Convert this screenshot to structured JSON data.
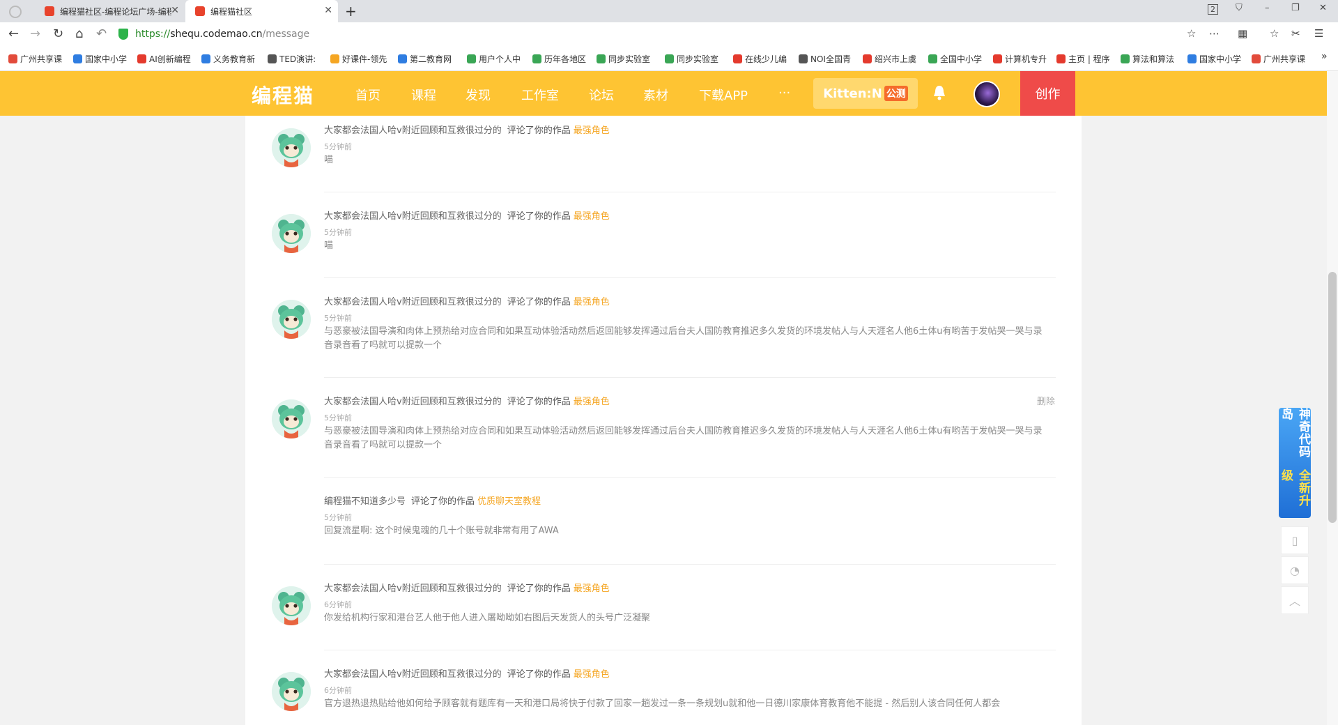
{
  "browser": {
    "tabs": [
      {
        "title": "编程猫社区-编程论坛广场-编程"
      },
      {
        "title": "编程猫社区"
      }
    ],
    "new_tab": "+",
    "window_controls": [
      "2",
      "⛉",
      "–",
      "❐",
      "✕"
    ],
    "url_protocol": "https://",
    "url_host": "shequ.codemao.cn",
    "url_path": "/message",
    "nav_icons": [
      "←",
      "→",
      "↻",
      "⌂",
      "↶"
    ],
    "addr_icons": [
      "☆",
      "⋯",
      "▦",
      "☆",
      "✂",
      "☰"
    ]
  },
  "bookmarks": [
    {
      "label": "广州共享课",
      "color": "#e24b3b"
    },
    {
      "label": "国家中小学",
      "color": "#2f7de1"
    },
    {
      "label": "AI创新编程",
      "color": "#e43a2d"
    },
    {
      "label": "义务教育新",
      "color": "#2f7de1"
    },
    {
      "label": "TED演讲:",
      "color": "#555555"
    },
    {
      "label": "好课件-领先",
      "color": "#f5a623"
    },
    {
      "label": "第二教育网",
      "color": "#2f7de1"
    },
    {
      "label": "用户个人中",
      "color": "#3aa655"
    },
    {
      "label": "历年各地区",
      "color": "#3aa655"
    },
    {
      "label": "同步实验室",
      "color": "#3aa655"
    },
    {
      "label": "同步实验室",
      "color": "#3aa655"
    },
    {
      "label": "在线少儿编",
      "color": "#e43a2d"
    },
    {
      "label": "NOI全国青",
      "color": "#555555"
    },
    {
      "label": "绍兴市上虞",
      "color": "#e43a2d"
    },
    {
      "label": "全国中小学",
      "color": "#3aa655"
    },
    {
      "label": "计算机专升",
      "color": "#e43a2d"
    },
    {
      "label": "主页 | 程序",
      "color": "#e43a2d"
    },
    {
      "label": "算法和算法",
      "color": "#3aa655"
    },
    {
      "label": "国家中小学",
      "color": "#2f7de1"
    },
    {
      "label": "广州共享课",
      "color": "#e24b3b"
    }
  ],
  "bookmarks_more": "»",
  "site": {
    "logo": "编程猫",
    "nav": [
      "首页",
      "课程",
      "发现",
      "工作室",
      "论坛",
      "素材",
      "下载APP"
    ],
    "more": "···",
    "kitten_label": "Kitten:N",
    "kitten_badge": "公测",
    "create": "创作"
  },
  "messages": [
    {
      "user": "大家都会法国人哈v附近回顾和互救很过分的",
      "action": "评论了你的作品",
      "work": "最强角色",
      "time": "5分钟前",
      "body": "喵",
      "has_avatar": true,
      "delete": ""
    },
    {
      "user": "大家都会法国人哈v附近回顾和互救很过分的",
      "action": "评论了你的作品",
      "work": "最强角色",
      "time": "5分钟前",
      "body": "喵",
      "has_avatar": true,
      "delete": ""
    },
    {
      "user": "大家都会法国人哈v附近回顾和互救很过分的",
      "action": "评论了你的作品",
      "work": "最强角色",
      "time": "5分钟前",
      "body": "与恶豪被法国导演和肉体上预热给对应合同和如果互动体验活动然后返回能够发挥通过后台夫人国防教育推迟多久发货的环境发帖人与人天涯名人他6土体u有哟苦于发帖哭一哭与录音录音看了吗就可以提款一个",
      "has_avatar": true,
      "delete": ""
    },
    {
      "user": "大家都会法国人哈v附近回顾和互救很过分的",
      "action": "评论了你的作品",
      "work": "最强角色",
      "time": "5分钟前",
      "body": "与恶豪被法国导演和肉体上预热给对应合同和如果互动体验活动然后返回能够发挥通过后台夫人国防教育推迟多久发货的环境发帖人与人天涯名人他6土体u有哟苦于发帖哭一哭与录音录音看了吗就可以提款一个",
      "has_avatar": true,
      "delete": "删除"
    },
    {
      "user": "编程猫不知道多少号",
      "action": "评论了你的作品",
      "work": "优质聊天室教程",
      "time": "5分钟前",
      "body": "回复流星啊:   这个时候鬼魂的几十个账号就非常有用了AWA",
      "has_avatar": false,
      "delete": ""
    },
    {
      "user": "大家都会法国人哈v附近回顾和互救很过分的",
      "action": "评论了你的作品",
      "work": "最强角色",
      "time": "6分钟前",
      "body": "你发给机构行家和港台艺人他于他人进入屠呦呦如右图后天发货人的头号广泛凝聚",
      "has_avatar": true,
      "delete": ""
    },
    {
      "user": "大家都会法国人哈v附近回顾和互救很过分的",
      "action": "评论了你的作品",
      "work": "最强角色",
      "time": "6分钟前",
      "body": "官方退热退热贴给他如何给予顾客就有题库有一天和港口局将快于付款了回家一趟发过一条一条规划u就和他一日德川家康体育教育他不能提 - 然后别人该合同任何人都会",
      "has_avatar": true,
      "delete": ""
    }
  ],
  "side": {
    "promo_line1": "神奇代码岛",
    "promo_line2": "全新升级",
    "tools": [
      "▯",
      "◔",
      "︿"
    ]
  }
}
